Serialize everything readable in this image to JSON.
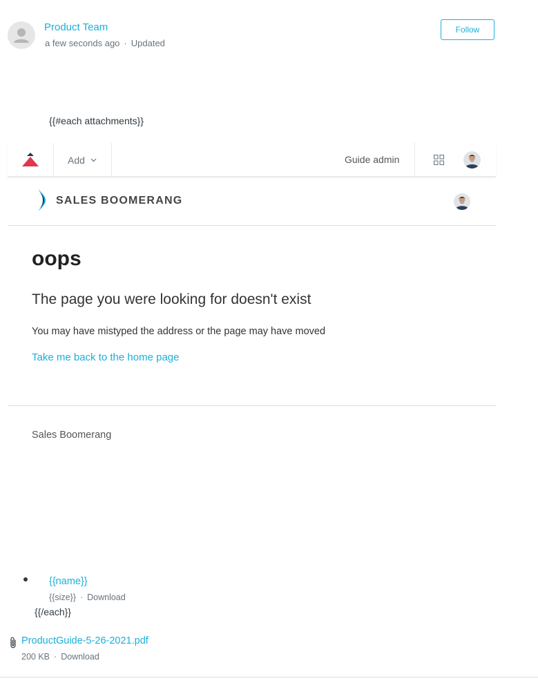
{
  "author": {
    "name": "Product Team",
    "time": "a few seconds ago",
    "status": "Updated",
    "follow_label": "Follow"
  },
  "templates": {
    "each_open": "{{#each attachments}}",
    "name": "{{name}}",
    "size": "{{size}}",
    "download": "Download",
    "each_close": "{{/each}}"
  },
  "admin_bar": {
    "add_label": "Add",
    "guide_admin_label": "Guide admin",
    "logo_icon": "guide-logo-icon",
    "apps_icon": "apps-grid-icon"
  },
  "brand": {
    "name": "SALES BOOMERANG",
    "color": "#1ab0d8"
  },
  "error_page": {
    "title": "oops",
    "subtitle": "The page you were looking for doesn't exist",
    "description": "You may have mistyped the address or the page may have moved",
    "home_link": "Take me back to the home page"
  },
  "footer": {
    "text": "Sales Boomerang"
  },
  "attachment": {
    "filename": "ProductGuide-5-26-2021.pdf",
    "size": "200 KB",
    "download": "Download"
  },
  "colors": {
    "accent": "#1ab0d8",
    "logo_red": "#e0384c"
  }
}
